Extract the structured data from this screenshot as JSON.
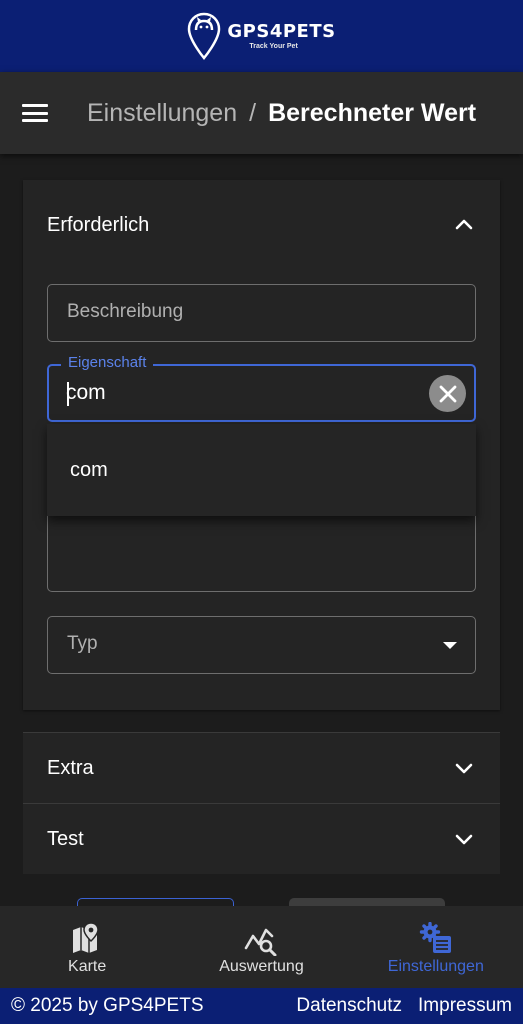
{
  "brand": {
    "name": "GPS4PETS",
    "tagline": "Track Your Pet",
    "color": "#0b1f74"
  },
  "header": {
    "menu_icon": "hamburger-menu-icon",
    "breadcrumb_parent": "Einstellungen",
    "breadcrumb_separator": "/",
    "breadcrumb_current": "Berechneter Wert"
  },
  "form": {
    "section_required": {
      "title": "Erforderlich",
      "expanded": true,
      "description_placeholder": "Beschreibung",
      "property_label": "Eigenschaft",
      "property_value": "com",
      "property_suggestions": [
        "com"
      ],
      "type_placeholder": "Typ"
    },
    "section_extra": {
      "title": "Extra",
      "expanded": false
    },
    "section_test": {
      "title": "Test",
      "expanded": false
    }
  },
  "bottom_nav": {
    "items": [
      {
        "label": "Karte",
        "icon": "map-icon",
        "active": false
      },
      {
        "label": "Auswertung",
        "icon": "chart-search-icon",
        "active": false
      },
      {
        "label": "Einstellungen",
        "icon": "settings-gears-icon",
        "active": true
      }
    ]
  },
  "footer": {
    "copyright": "© 2025 by GPS4PETS",
    "links": [
      "Datenschutz",
      "Impressum"
    ]
  },
  "colors": {
    "accent": "#3f67d6",
    "background": "#1c1c1c",
    "panel": "#242424"
  }
}
